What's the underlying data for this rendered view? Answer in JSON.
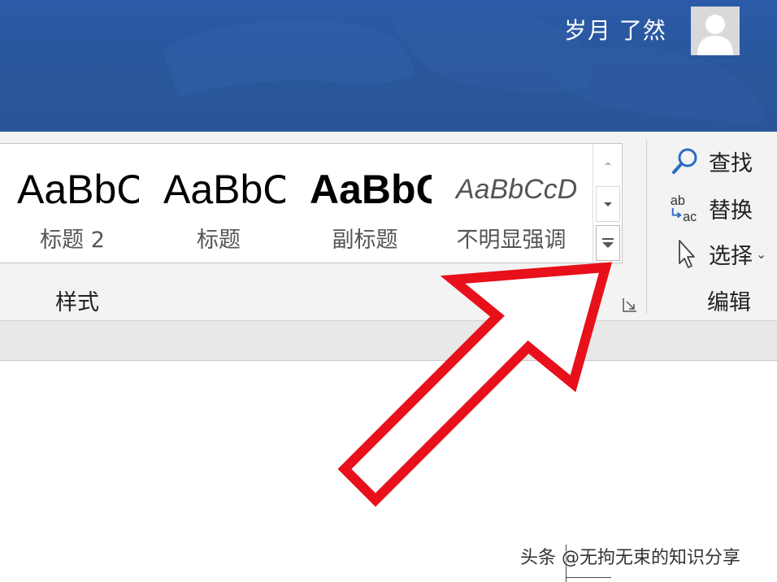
{
  "titlebar": {
    "username": "岁月 了然",
    "bg_color": "#2a579a"
  },
  "ribbon": {
    "styles_gallery": [
      {
        "sample": "AaBbC",
        "name": "标题 2"
      },
      {
        "sample": "AaBbC",
        "name": "标题"
      },
      {
        "sample": "AaBbC",
        "name": "副标题"
      },
      {
        "sample": "AaBbCcDd",
        "name": "不明显强调"
      }
    ],
    "styles_group_label": "样式",
    "editing_group_label": "编辑",
    "find_label": "查找",
    "replace_label": "替换",
    "select_label": "选择",
    "replace_icon_top": "ab",
    "replace_icon_bottom": "ac",
    "icons": {
      "scroll_up": "chevron-up-icon",
      "scroll_down": "chevron-down-icon",
      "more": "more-styles-icon",
      "launcher": "dialog-launcher-icon",
      "find": "search-icon",
      "replace": "replace-icon",
      "select": "cursor-icon"
    }
  },
  "annotation": {
    "arrow_color": "#e8101a"
  },
  "watermark": "头条 @无拘无束的知识分享"
}
